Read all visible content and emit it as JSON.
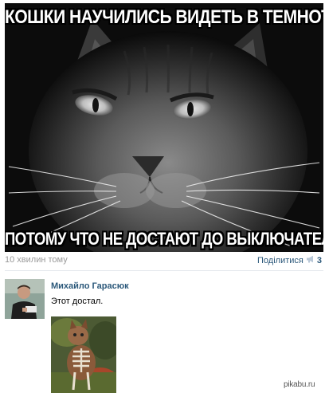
{
  "meme": {
    "top_caption": "Кошки научились видеть в темноте,",
    "bottom_caption": "потому что не достают до выключателя"
  },
  "post_meta": {
    "time": "10 хвилин тому",
    "share_label": "Поділитися",
    "share_count": "3",
    "share_icon": "megaphone-icon",
    "link_color": "#2b587a"
  },
  "comment": {
    "author": "Михайло Гарасюк",
    "text": "Этот достал."
  },
  "watermark": "pikabu.ru"
}
